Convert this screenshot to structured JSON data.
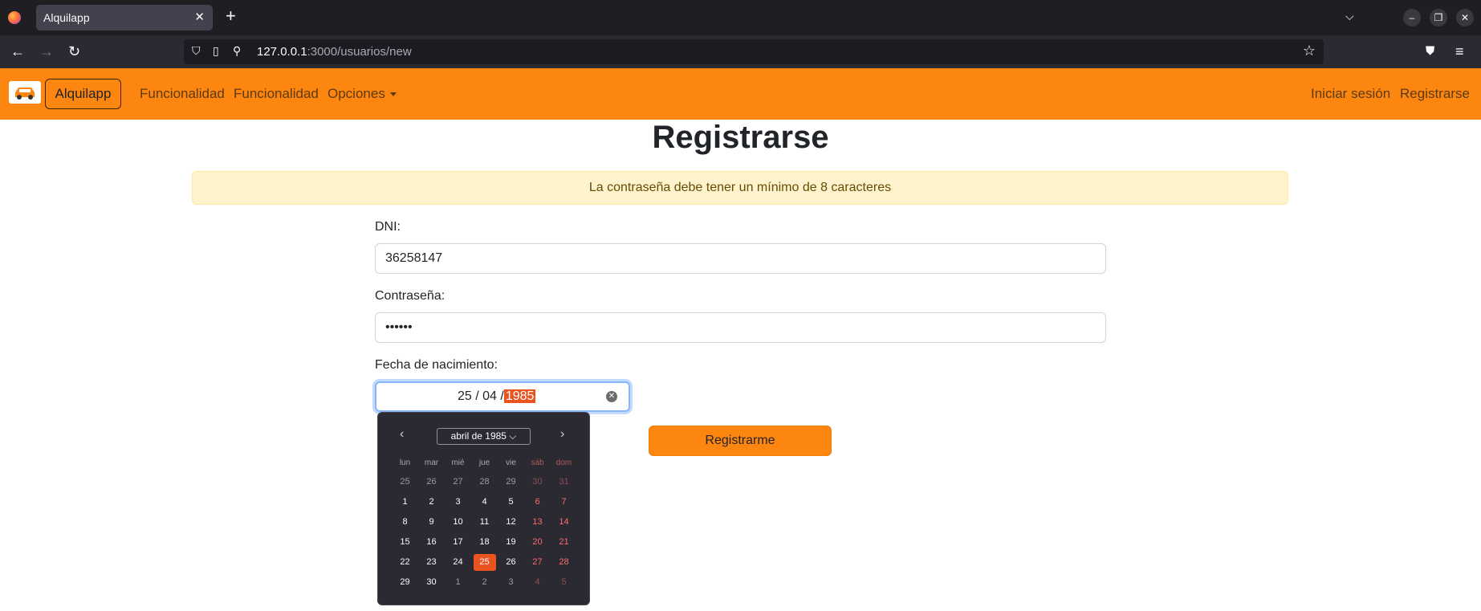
{
  "browser": {
    "tab_title": "Alquilapp",
    "url_host": "127.0.0.1",
    "url_rest": ":3000/usuarios/new"
  },
  "site": {
    "brand": "Alquilapp",
    "nav_left": [
      "Funcionalidad",
      "Funcionalidad",
      "Opciones"
    ],
    "nav_right": [
      "Iniciar sesión",
      "Registrarse"
    ],
    "accent_color": "#fd8611"
  },
  "form": {
    "title": "Registrarse",
    "alert": "La contraseña debe tener un mínimo de 8 caracteres",
    "dni_label": "DNI:",
    "dni_value": "36258147",
    "password_label": "Contraseña:",
    "password_value": "••••••",
    "birth_label": "Fecha de nacimiento:",
    "birth_day": "25",
    "birth_month": "04",
    "birth_year": "1985",
    "sep": "/",
    "submit": "Registrarme"
  },
  "datepicker": {
    "month_label": "abril de 1985",
    "weekdays": [
      "lun",
      "mar",
      "mié",
      "jue",
      "vie",
      "sáb",
      "dom"
    ],
    "weeks": [
      [
        "25",
        "26",
        "27",
        "28",
        "29",
        "30",
        "31"
      ],
      [
        "1",
        "2",
        "3",
        "4",
        "5",
        "6",
        "7"
      ],
      [
        "8",
        "9",
        "10",
        "11",
        "12",
        "13",
        "14"
      ],
      [
        "15",
        "16",
        "17",
        "18",
        "19",
        "20",
        "21"
      ],
      [
        "22",
        "23",
        "24",
        "25",
        "26",
        "27",
        "28"
      ],
      [
        "29",
        "30",
        "1",
        "2",
        "3",
        "4",
        "5"
      ]
    ],
    "selected_day": "25",
    "selected_color": "#e95420"
  }
}
